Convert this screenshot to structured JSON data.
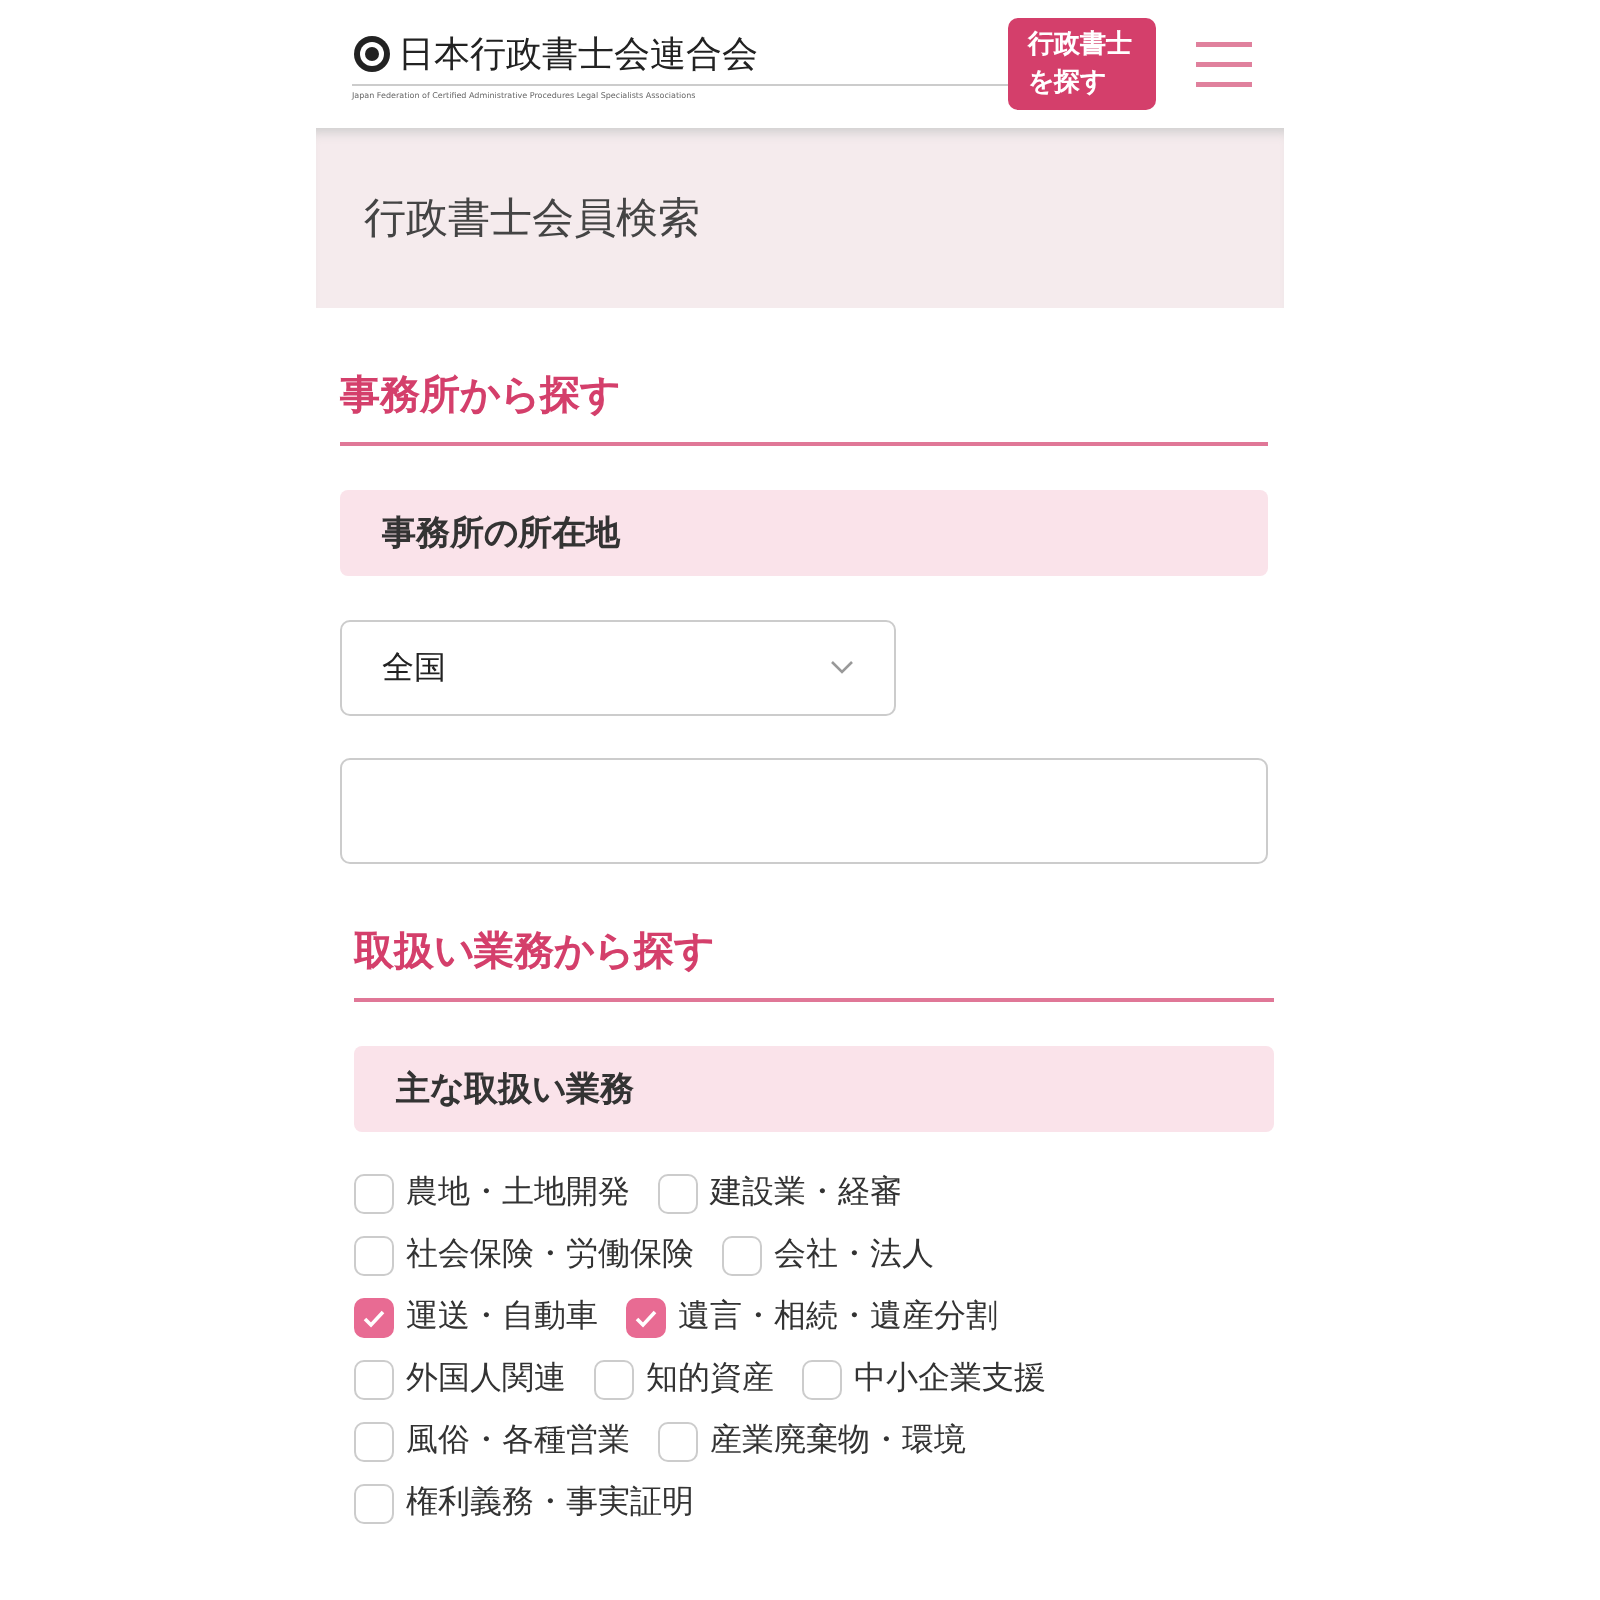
{
  "header": {
    "logo_title": "日本行政書士会連合会",
    "logo_subtitle": "Japan Federation of Certified Administrative Procedures Legal Specialists Associations",
    "search_button": "行政書士を探す"
  },
  "banner": {
    "title": "行政書士会員検索"
  },
  "office_section": {
    "heading": "事務所から探す",
    "subheading": "事務所の所在地",
    "select": {
      "value": "全国"
    }
  },
  "work_section": {
    "heading": "取扱い業務から探す",
    "subheading": "主な取扱い業務",
    "option_rows": [
      [
        {
          "label": "農地・土地開発",
          "checked": false
        },
        {
          "label": "建設業・経審",
          "checked": false
        }
      ],
      [
        {
          "label": "社会保険・労働保険",
          "checked": false
        },
        {
          "label": "会社・法人",
          "checked": false
        }
      ],
      [
        {
          "label": "運送・自動車",
          "checked": true
        },
        {
          "label": "遺言・相続・遺産分割",
          "checked": true
        }
      ],
      [
        {
          "label": "外国人関連",
          "checked": false
        },
        {
          "label": "知的資産",
          "checked": false
        },
        {
          "label": "中小企業支援",
          "checked": false
        }
      ],
      [
        {
          "label": "風俗・各種営業",
          "checked": false
        },
        {
          "label": "産業廃棄物・環境",
          "checked": false
        }
      ],
      [
        {
          "label": "権利義務・事実証明",
          "checked": false
        }
      ]
    ]
  }
}
